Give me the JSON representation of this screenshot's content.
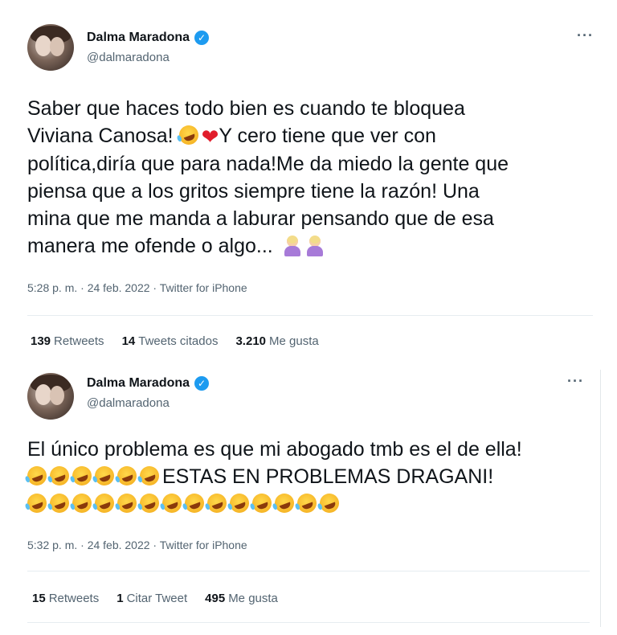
{
  "tweets": [
    {
      "author": "Dalma Maradona",
      "handle": "@dalmaradona",
      "more": "···",
      "text_line1": "Saber que haces todo bien es cuando te bloquea",
      "text_line2": "Viviana Canosa! ",
      "text_line2b": "Y cero tiene que ver con",
      "text_line3": "política,diría que para nada!Me da miedo la gente que",
      "text_line4": "piensa que a los gritos siempre tiene la razón! Una",
      "text_line5": "mina que me manda a laburar pensando que de esa",
      "text_line6": "manera me ofende o algo... ",
      "meta": "5:28 p. m. · 24 feb. 2022 · Twitter for iPhone",
      "stats": [
        {
          "value": "139",
          "label": "Retweets"
        },
        {
          "value": "14",
          "label": "Tweets citados"
        },
        {
          "value": "3.210",
          "label": "Me gusta"
        }
      ]
    },
    {
      "author": "Dalma Maradona",
      "handle": "@dalmaradona",
      "more": "···",
      "text_line1": "El único problema es que mi abogado tmb es el de ella!",
      "text_line2": "ESTAS EN PROBLEMAS DRAGANI!",
      "meta": "5:32 p. m. · 24 feb. 2022 · Twitter for iPhone",
      "stats": [
        {
          "value": "15",
          "label": "Retweets"
        },
        {
          "value": "1",
          "label": "Citar Tweet"
        },
        {
          "value": "495",
          "label": "Me gusta"
        }
      ]
    }
  ],
  "icons": {
    "verified": "verified-badge-icon",
    "emoji_laugh": "rolling-on-floor-laughing-emoji",
    "emoji_heart": "red-heart-emoji",
    "emoji_person": "person-gesturing-emoji"
  },
  "colors": {
    "accent": "#1d9bf0",
    "text": "#0f1419",
    "secondary": "#536471"
  }
}
